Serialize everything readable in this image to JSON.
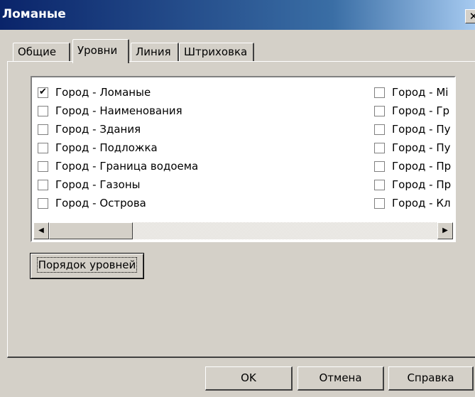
{
  "window": {
    "title": "Ломаные",
    "close_label": "✕"
  },
  "tabs": [
    {
      "label": "Общие",
      "active": false
    },
    {
      "label": "Уровни",
      "active": true
    },
    {
      "label": "Линия",
      "active": false
    },
    {
      "label": "Штриховка",
      "active": false
    }
  ],
  "levels": {
    "left_column": [
      {
        "label": "Город - Ломаные",
        "checked": true
      },
      {
        "label": "Город - Наименования",
        "checked": false
      },
      {
        "label": "Город - Здания",
        "checked": false
      },
      {
        "label": "Город - Подложка",
        "checked": false
      },
      {
        "label": "Город - Граница водоема",
        "checked": false
      },
      {
        "label": "Город - Газоны",
        "checked": false
      },
      {
        "label": "Город - Острова",
        "checked": false
      }
    ],
    "right_column": [
      {
        "label": "Город - Мі",
        "checked": false
      },
      {
        "label": "Город - Гр",
        "checked": false
      },
      {
        "label": "Город - Пу",
        "checked": false
      },
      {
        "label": "Город - Пу",
        "checked": false
      },
      {
        "label": "Город - Пр",
        "checked": false
      },
      {
        "label": "Город - Пр",
        "checked": false
      },
      {
        "label": "Город - Кл",
        "checked": false
      }
    ],
    "scroll_left_icon": "◀",
    "scroll_right_icon": "▶",
    "check_mark": "✔"
  },
  "buttons": {
    "level_order": "Порядок уровней",
    "ok": "OK",
    "cancel": "Отмена",
    "help": "Справка"
  }
}
